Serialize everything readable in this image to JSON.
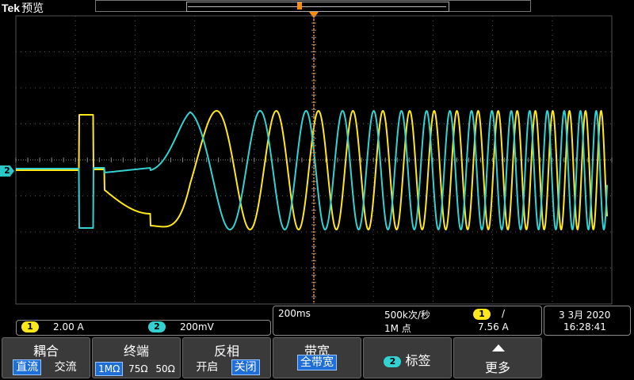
{
  "header": {
    "brand": "Tek",
    "mode": "预览"
  },
  "channel_tags": {
    "ch2": "2"
  },
  "readout": {
    "ch1": {
      "num": "1",
      "scale": "2.00 A"
    },
    "ch2": {
      "num": "2",
      "scale": "200mV"
    }
  },
  "timebase": {
    "scale": "200ms",
    "rate": "500k次/秒",
    "points": "1M 点",
    "trigger_ch": "1",
    "trigger_slope": "/",
    "trigger_level": "7.56 A"
  },
  "clock": {
    "date": "3 3月 2020",
    "time": "16:28:41"
  },
  "menu": {
    "coupling": {
      "title": "耦合",
      "opts": [
        "直流",
        "交流"
      ]
    },
    "termination": {
      "title": "终端",
      "opts": [
        "1MΩ",
        "75Ω",
        "50Ω"
      ]
    },
    "invert": {
      "title": "反相",
      "opts": [
        "开启",
        "关闭"
      ]
    },
    "bandwidth": {
      "title": "带宽",
      "value": "全带宽"
    },
    "label": {
      "num": "2",
      "title": "标签"
    },
    "more": {
      "title": "更多"
    }
  },
  "colors": {
    "ch1": "#ffe81a",
    "ch2": "#32d2d2",
    "grid": "#555555",
    "trigger": "#ff8c00"
  }
}
